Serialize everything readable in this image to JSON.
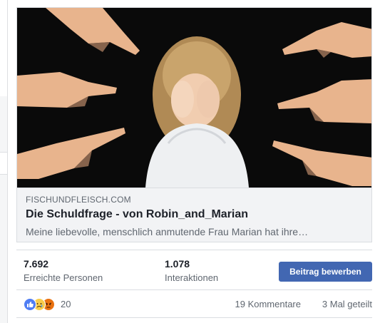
{
  "link_preview": {
    "domain": "FISCHUNDFLEISCH.COM",
    "title": "Die Schuldfrage - von Robin_and_Marian",
    "description": "Meine liebevolle, menschlich anmutende Frau Marian hat ihre…"
  },
  "insights": {
    "reach_value": "7.692",
    "reach_label": "Erreichte Personen",
    "engagement_value": "1.078",
    "engagement_label": "Interaktionen",
    "boost_button": "Beitrag bewerben"
  },
  "engagement_bar": {
    "reaction_icons": [
      "like-icon",
      "sad-icon",
      "angry-icon"
    ],
    "reaction_count": "20",
    "comments": "19 Kommentare",
    "shares": "3 Mal geteilt"
  },
  "colors": {
    "accent": "#4267b2",
    "like": "#4f7df3",
    "sad": "#f7cc4a",
    "angry": "#e9710f"
  }
}
